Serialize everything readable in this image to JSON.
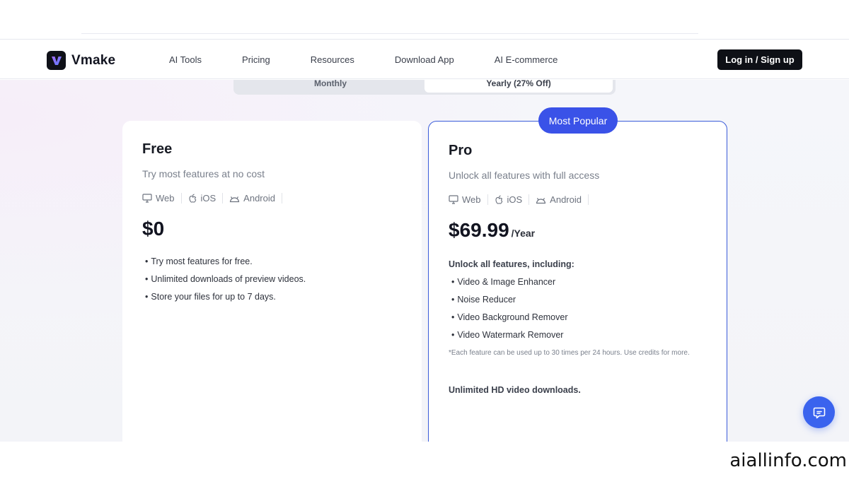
{
  "brand": {
    "name": "Vmake"
  },
  "nav": {
    "items": [
      "AI Tools",
      "Pricing",
      "Resources",
      "Download App",
      "AI E-commerce"
    ],
    "login_label": "Log in / Sign up"
  },
  "billing_toggle": {
    "monthly": "Monthly",
    "yearly": "Yearly (27% Off)",
    "selected": "yearly"
  },
  "plans": {
    "free": {
      "name": "Free",
      "description": "Try most features at no cost",
      "platforms": [
        "Web",
        "iOS",
        "Android"
      ],
      "price": "$0",
      "features": [
        "Try most features for free.",
        "Unlimited downloads of preview videos.",
        "Store your files for up to 7 days."
      ]
    },
    "pro": {
      "badge": "Most Popular",
      "name": "Pro",
      "description": "Unlock all features with full access",
      "platforms": [
        "Web",
        "iOS",
        "Android"
      ],
      "price": "$69.99",
      "period": "/Year",
      "unlock_title": "Unlock all features, including:",
      "features": [
        "Video & Image Enhancer",
        "Noise Reducer",
        "Video Background Remover",
        "Video Watermark Remover"
      ],
      "footnote": "*Each feature can be used up to 30 times per 24 hours. Use credits for more.",
      "hd_note": "Unlimited HD video downloads."
    }
  },
  "watermark": "aiallinfo.com",
  "colors": {
    "accent": "#3a52e8",
    "pro_border": "#3a5bd9",
    "login_bg": "#0e1016",
    "chat": "#3a63ee"
  }
}
